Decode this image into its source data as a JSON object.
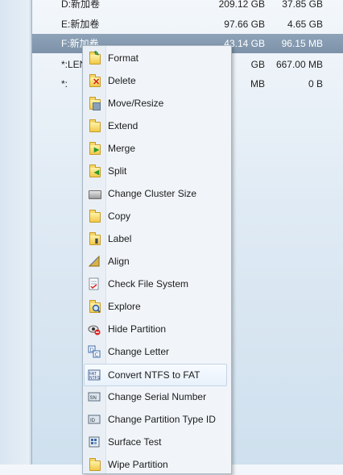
{
  "partitions": [
    {
      "name": "D:新加卷",
      "capacity": "209.12 GB",
      "free": "37.85 GB"
    },
    {
      "name": "E:新加卷",
      "capacity": "97.66 GB",
      "free": "4.65 GB"
    },
    {
      "name": "F:新加卷",
      "capacity": "43.14 GB",
      "free": "96.15 MB"
    },
    {
      "name": "*:LEN",
      "capacity": "GB",
      "free": "667.00 MB"
    },
    {
      "name": "*:",
      "capacity": "MB",
      "free": "0 B"
    }
  ],
  "menu": {
    "items": [
      {
        "label": "Format",
        "icon": "format-icon"
      },
      {
        "label": "Delete",
        "icon": "delete-icon"
      },
      {
        "label": "Move/Resize",
        "icon": "move-resize-icon"
      },
      {
        "label": "Extend",
        "icon": "extend-icon"
      },
      {
        "label": "Merge",
        "icon": "merge-icon"
      },
      {
        "label": "Split",
        "icon": "split-icon"
      },
      {
        "label": "Change Cluster Size",
        "icon": "cluster-size-icon"
      },
      {
        "label": "Copy",
        "icon": "copy-icon"
      },
      {
        "label": "Label",
        "icon": "label-icon"
      },
      {
        "label": "Align",
        "icon": "align-icon"
      },
      {
        "label": "Check File System",
        "icon": "check-file-system-icon"
      },
      {
        "label": "Explore",
        "icon": "explore-icon"
      },
      {
        "label": "Hide Partition",
        "icon": "hide-partition-icon"
      },
      {
        "label": "Change Letter",
        "icon": "change-letter-icon"
      },
      {
        "label": "Convert NTFS to FAT",
        "icon": "convert-ntfs-fat-icon"
      },
      {
        "label": "Change Serial Number",
        "icon": "serial-number-icon"
      },
      {
        "label": "Change Partition Type ID",
        "icon": "partition-type-id-icon"
      },
      {
        "label": "Surface Test",
        "icon": "surface-test-icon"
      },
      {
        "label": "Wipe Partition",
        "icon": "wipe-partition-icon"
      }
    ],
    "highlighted": "Convert NTFS to FAT"
  }
}
